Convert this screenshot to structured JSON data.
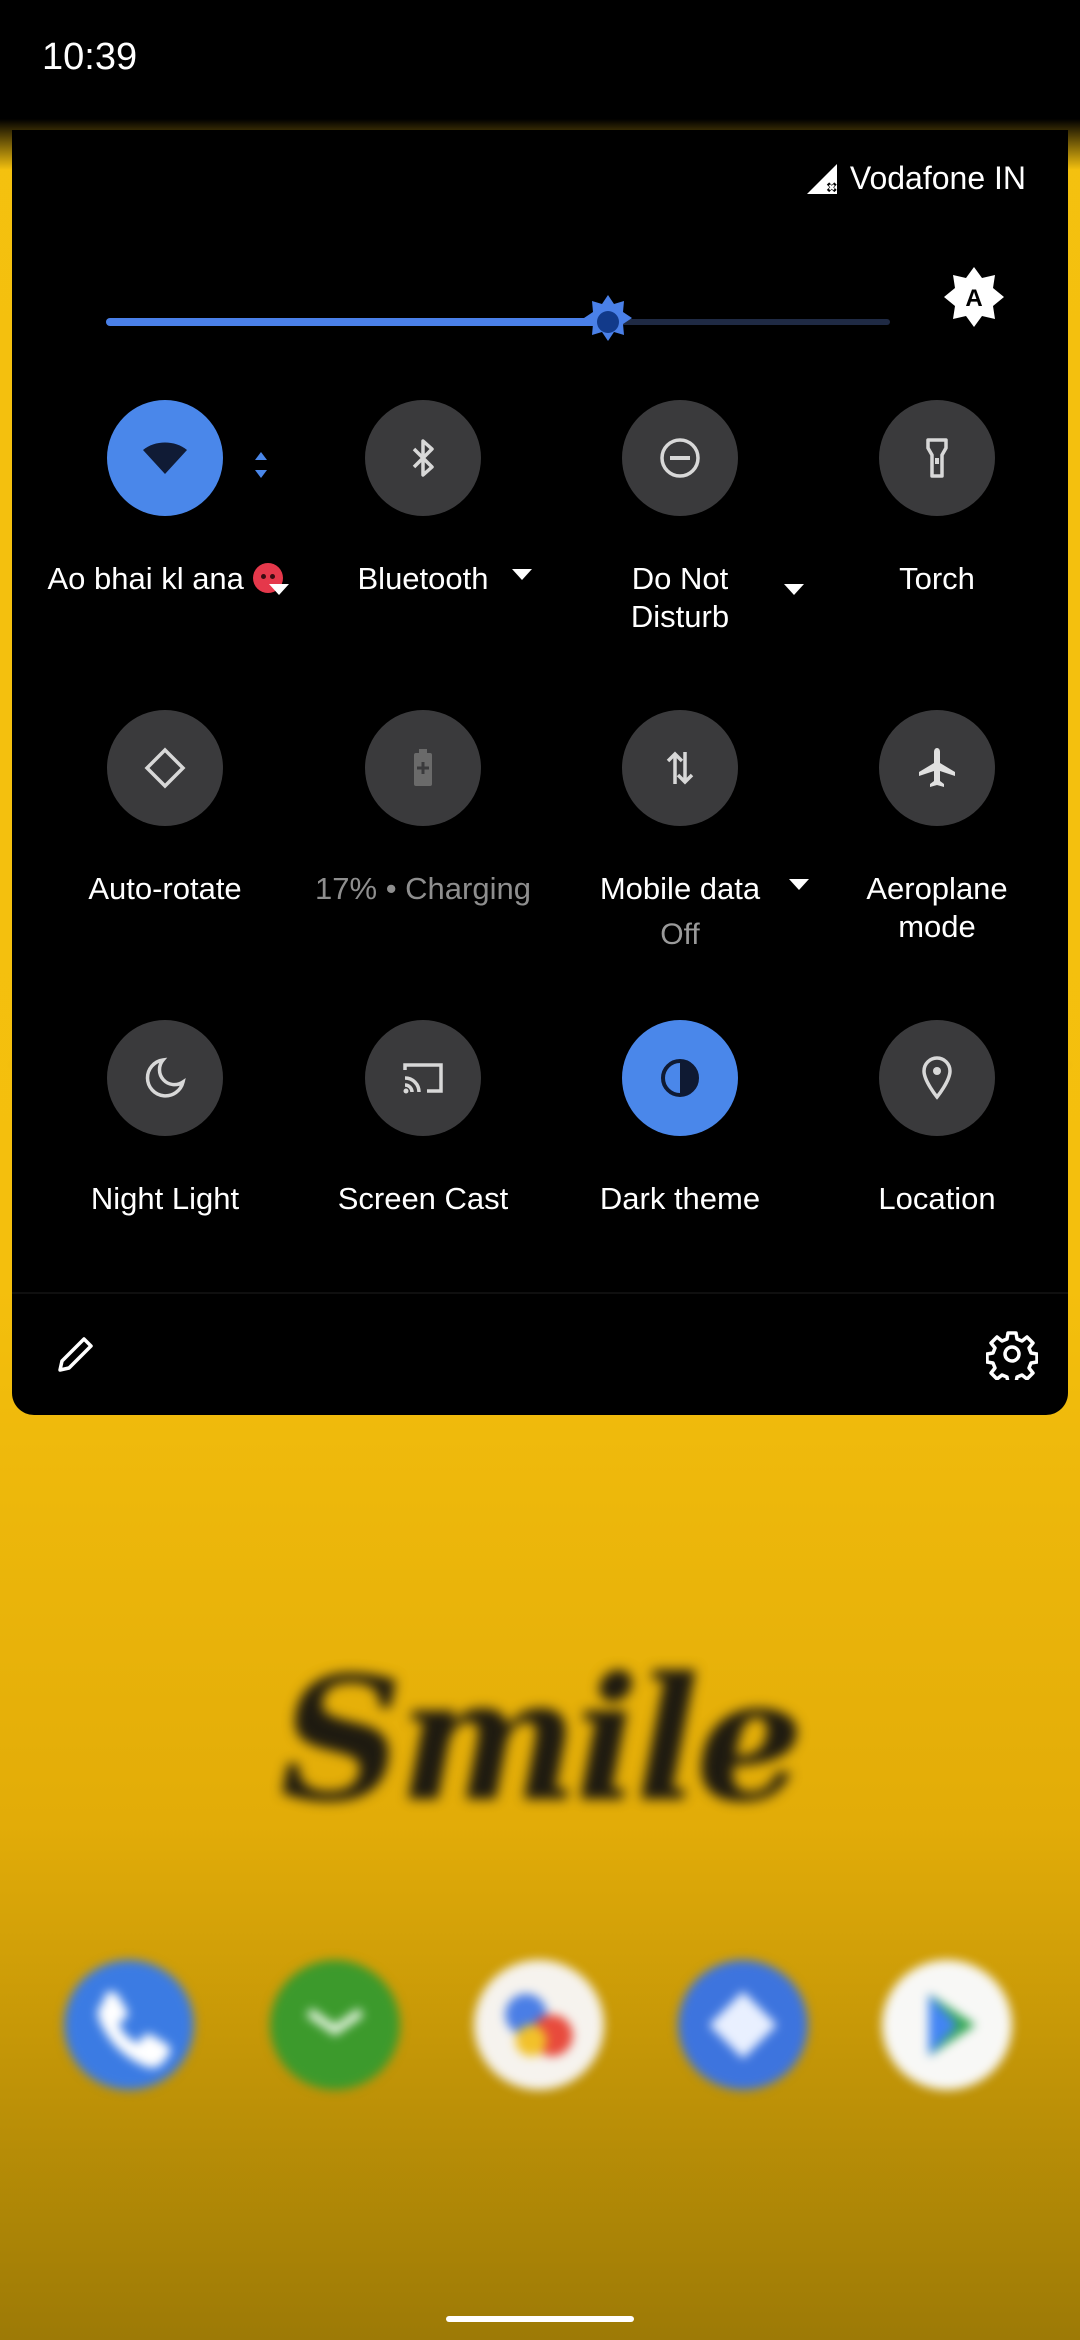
{
  "status_bar": {
    "time": "10:39"
  },
  "quick_settings": {
    "carrier": "Vodafone IN",
    "brightness_level": 0.64,
    "tiles": [
      {
        "id": "wifi",
        "label": "Ao bhai kl ana",
        "icon": "wifi-icon",
        "state": "on",
        "has_dropdown": true
      },
      {
        "id": "bluetooth",
        "label": "Bluetooth",
        "icon": "bluetooth-icon",
        "state": "off",
        "has_dropdown": true
      },
      {
        "id": "dnd",
        "label": "Do Not Disturb",
        "icon": "dnd-icon",
        "state": "off",
        "has_dropdown": true
      },
      {
        "id": "torch",
        "label": "Torch",
        "icon": "torch-icon",
        "state": "off"
      },
      {
        "id": "autorotate",
        "label": "Auto-rotate",
        "icon": "auto-rotate-icon",
        "state": "off"
      },
      {
        "id": "battery",
        "label": "17% • Charging",
        "icon": "battery-icon",
        "state": "unavailable"
      },
      {
        "id": "mobiledata",
        "label": "Mobile data",
        "sublabel": "Off",
        "icon": "mobile-data-icon",
        "state": "off",
        "has_dropdown": true
      },
      {
        "id": "aeroplane",
        "label": "Aeroplane mode",
        "icon": "airplane-icon",
        "state": "off"
      },
      {
        "id": "nightlight",
        "label": "Night Light",
        "icon": "moon-icon",
        "state": "off"
      },
      {
        "id": "screencast",
        "label": "Screen Cast",
        "icon": "cast-icon",
        "state": "off"
      },
      {
        "id": "darktheme",
        "label": "Dark theme",
        "icon": "dark-theme-icon",
        "state": "on"
      },
      {
        "id": "location",
        "label": "Location",
        "icon": "location-pin-icon",
        "state": "off"
      }
    ]
  },
  "wallpaper": {
    "text": "Smile"
  },
  "dock": [
    "phone-app-icon",
    "messages-app-icon",
    "photos-app-icon",
    "maps-app-icon",
    "play-store-icon"
  ],
  "colors": {
    "accent": "#4a87ea",
    "tile_off": "#3a3a3c",
    "wallpaper": "#f4c10f"
  }
}
